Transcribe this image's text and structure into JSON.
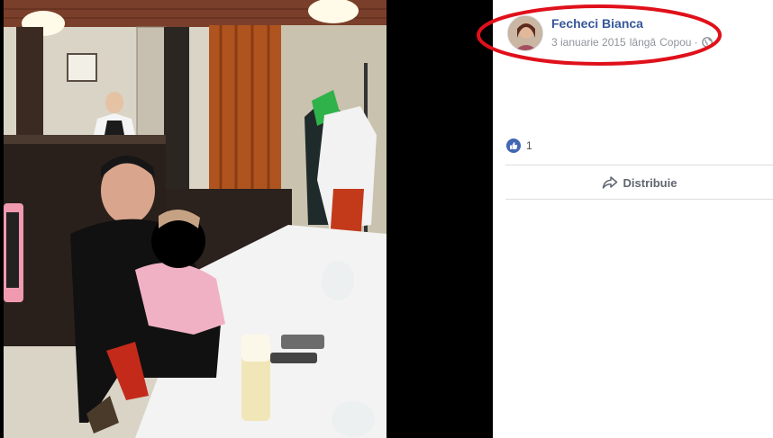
{
  "post": {
    "author_name": "Fecheci Bianca",
    "date": "3 ianuarie 2015",
    "location_prefix": "lângă",
    "location": "Copou",
    "separator": "·",
    "privacy_icon": "globe-icon",
    "avatar": "profile-photo-avatar"
  },
  "reactions": {
    "icon": "like-icon",
    "count": "1"
  },
  "actions": {
    "share_label": "Distribuie",
    "share_icon": "share-arrow-icon"
  },
  "photo": {
    "description_icon": "photo"
  },
  "colors": {
    "link_blue": "#365899",
    "meta_gray": "#90949c",
    "like_blue": "#4267b2",
    "highlight_red": "#e0101a",
    "divider": "#dadde1"
  }
}
